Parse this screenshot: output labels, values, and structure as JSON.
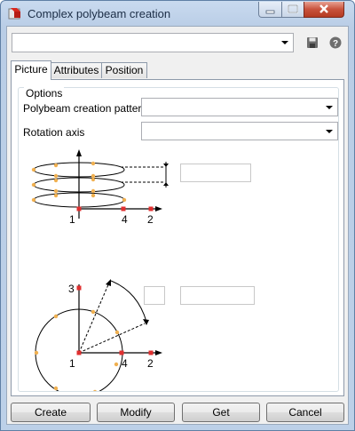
{
  "window": {
    "title": "Complex polybeam creation"
  },
  "toolbar": {
    "preset_value": "",
    "save_icon": "save-icon",
    "help_icon": "help-icon"
  },
  "tabs": [
    {
      "label": "Picture",
      "active": true
    },
    {
      "label": "Attributes",
      "active": false
    },
    {
      "label": "Position",
      "active": false
    }
  ],
  "options": {
    "group_label": "Options",
    "pattern_label": "Polybeam creation pattern",
    "pattern_value": "",
    "rotation_label": "Rotation axis",
    "rotation_value": ""
  },
  "helix_diagram": {
    "labels": [
      "1",
      "4",
      "2"
    ],
    "offset_value": ""
  },
  "circle_diagram": {
    "labels": [
      "3",
      "1",
      "4",
      "2"
    ],
    "count_value": "",
    "angle_value": ""
  },
  "buttons": {
    "create": "Create",
    "modify": "Modify",
    "get": "Get",
    "cancel": "Cancel"
  }
}
